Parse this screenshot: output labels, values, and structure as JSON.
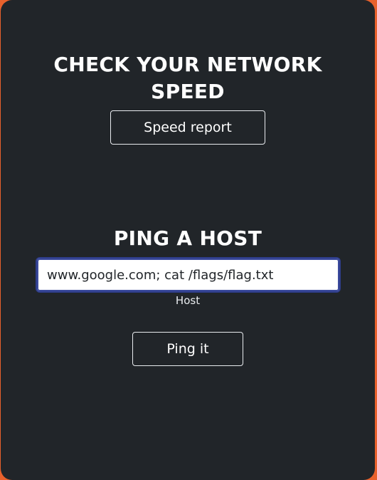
{
  "speed_section": {
    "heading_line1": "CHECK YOUR NETWORK",
    "heading_line2": "SPEED",
    "button_label": "Speed report"
  },
  "ping_section": {
    "heading": "PING A HOST",
    "host_input_value": "www.google.com; cat /flags/flag.txt",
    "host_label": "Host",
    "button_label": "Ping it"
  },
  "colors": {
    "page_background": "#e8612c",
    "card_background": "#212529",
    "input_focus_border": "#2f3e8c"
  }
}
